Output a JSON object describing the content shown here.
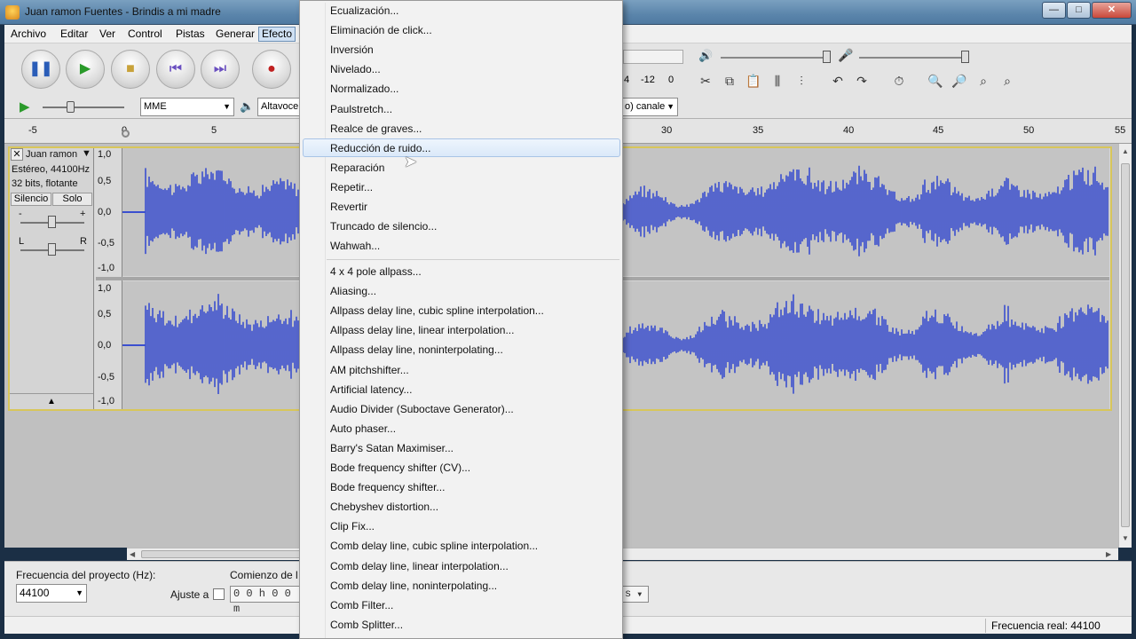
{
  "window": {
    "title": "Juan ramon Fuentes - Brindis a mi madre",
    "minimize_glyph": "—",
    "maximize_glyph": "□",
    "close_glyph": "✕"
  },
  "menubar": {
    "items": [
      "Archivo",
      "Editar",
      "Ver",
      "Control",
      "Pistas",
      "Generar",
      "Efecto"
    ]
  },
  "toolbar": {
    "device_host": "MME",
    "output_device": "Altavoce",
    "channels": "o) canale",
    "meter_left": "4",
    "meter_mid": "-12",
    "meter_right": "0",
    "transport_icons": [
      "pause-icon",
      "play-icon",
      "stop-icon",
      "skip-start-icon",
      "skip-end-icon",
      "record-icon"
    ]
  },
  "ruler": {
    "ticks_left": [
      "-5",
      "0",
      "5"
    ],
    "ticks_right": [
      "30",
      "35",
      "40",
      "45",
      "50",
      "55"
    ]
  },
  "track": {
    "name": "Juan ramon",
    "format_line1": "Estéreo, 44100Hz",
    "format_line2": "32 bits, flotante",
    "mute_label": "Silencio",
    "solo_label": "Solo",
    "gain_minus": "-",
    "gain_plus": "+",
    "pan_left": "L",
    "pan_right": "R",
    "scale_labels": [
      "1,0",
      "0,5",
      "0,0",
      "-0,5",
      "-1,0"
    ],
    "scale_labels_2": [
      "1,0",
      "0,5",
      "0,0",
      "-0,5",
      "-1,0"
    ],
    "waveform_color": "#3b4fcf"
  },
  "selection_bar": {
    "rate_label": "Frecuencia del proyecto (Hz):",
    "rate_value": "44100",
    "snap_label": "Ajuste a",
    "start_label": "Comienzo de l",
    "start_value": "0 0 h 0 0  m",
    "end_suffix": "s"
  },
  "status": {
    "actual_rate": "Frecuencia real: 44100"
  },
  "effect_menu": {
    "group1": [
      "Ecualización...",
      "Eliminación de click...",
      "Inversión",
      "Nivelado...",
      "Normalizado...",
      "Paulstretch...",
      "Realce de graves...",
      "Reducción de ruido...",
      "Reparación",
      "Repetir...",
      "Revertir",
      "Truncado de silencio...",
      "Wahwah..."
    ],
    "group2": [
      "4 x 4 pole allpass...",
      "Aliasing...",
      "Allpass delay line, cubic spline interpolation...",
      "Allpass delay line, linear interpolation...",
      "Allpass delay line, noninterpolating...",
      "AM pitchshifter...",
      "Artificial latency...",
      "Audio Divider (Subоctave Generator)...",
      "Auto phaser...",
      "Barry's Satan Maximiser...",
      "Bode frequency shifter (CV)...",
      "Bode frequency shifter...",
      "Chebyshev distortion...",
      "Clip Fix...",
      "Comb delay line, cubic spline interpolation...",
      "Comb delay line, linear interpolation...",
      "Comb delay line, noninterpolating...",
      "Comb Filter...",
      "Comb Splitter..."
    ],
    "highlighted": "Reducción de ruido..."
  }
}
